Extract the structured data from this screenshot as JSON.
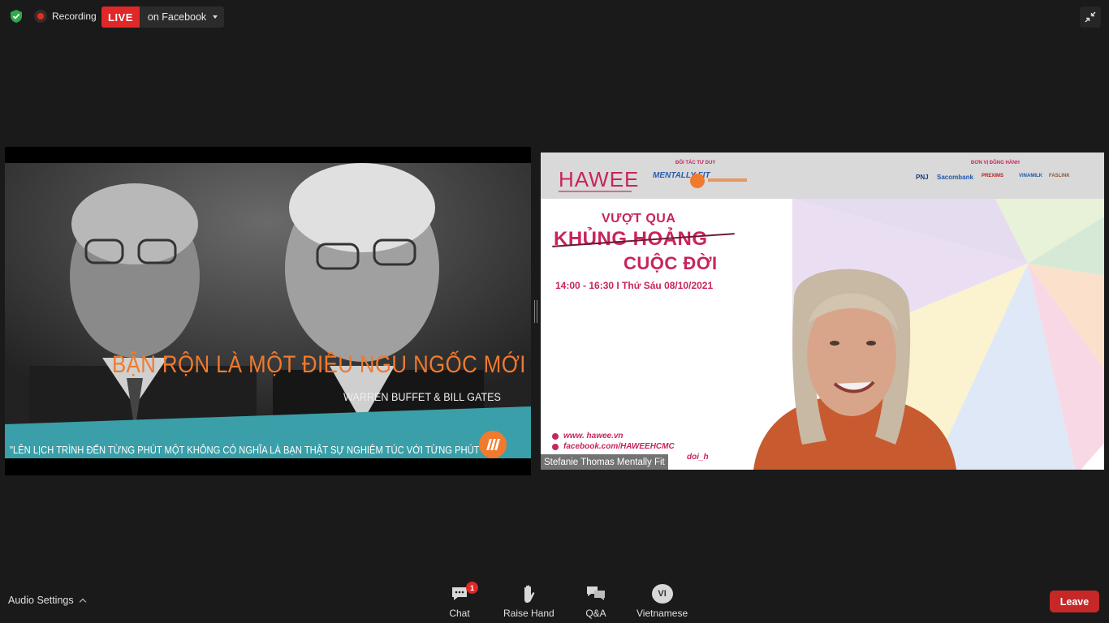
{
  "topbar": {
    "recording_label": "Recording",
    "live_label": "LIVE",
    "stream_target": "on Facebook"
  },
  "left_video": {
    "title": "BẬN RỘN LÀ MỘT ĐIỀU NGU NGỐC MỚI",
    "subtitle": "WARREN BUFFET & BILL GATES",
    "quote": "\"LÊN LỊCH TRÌNH ĐẾN TỪNG PHÚT MỘT KHÔNG CÓ NGHĨA LÀ BẠN THẬT SỰ NGHIÊM TÚC VỚI TỪNG PHÚT ĐÓ.\""
  },
  "right_video": {
    "brand": "HAWEE",
    "partner_label": "ĐỐI TÁC TƯ DUY",
    "partner_name": "MENTALLY FIT",
    "sponsor_label": "ĐƠN VỊ ĐỒNG HÀNH",
    "sponsors": [
      "PNJ",
      "Sacombank",
      "PREXIMS",
      "VINAMILK",
      "FASLINK"
    ],
    "title_line1": "VƯỢT QUA",
    "title_line2": "KHỦNG HOẢNG",
    "title_line3": "CUỘC ĐỜI",
    "schedule": "14:00 - 16:30  I  Thứ Sáu 08/10/2021",
    "link_web": "www. hawee.vn",
    "link_fb": "facebook.com/HAWEEHCMC",
    "link_hashtag": "doi_h",
    "participant_name": "Stefanie Thomas Mentally Fit"
  },
  "toolbar": {
    "audio_settings": "Audio Settings",
    "chat": "Chat",
    "chat_badge": "1",
    "raise_hand": "Raise Hand",
    "qa": "Q&A",
    "language_code": "VI",
    "language": "Vietnamese",
    "leave": "Leave"
  },
  "colors": {
    "live_red": "#e02828",
    "leave_red": "#c62828",
    "brand_pink": "#c8245e",
    "accent_orange": "#f07a2e",
    "teal_banner": "#3a9fa8"
  }
}
